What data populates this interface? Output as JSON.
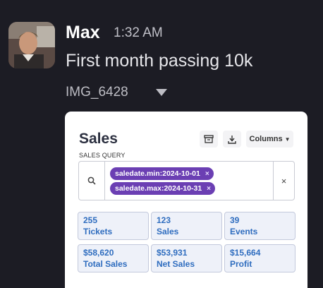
{
  "message": {
    "sender": "Max",
    "time": "1:32 AM",
    "text": "First month passing 10k",
    "attachment": {
      "name": "IMG_6428",
      "icon": "chevron-down-icon"
    }
  },
  "screenshot": {
    "title": "Sales",
    "toolbar": {
      "archive_icon": "archive-icon",
      "download_icon": "download-icon",
      "columns_label": "Columns"
    },
    "query": {
      "label": "SALES QUERY",
      "filters": [
        {
          "text": "saledate.min:2024-10-01"
        },
        {
          "text": "saledate.max:2024-10-31"
        }
      ],
      "remove_glyph": "×",
      "clear_glyph": "×"
    },
    "stats": [
      {
        "value": "255",
        "label": "Tickets"
      },
      {
        "value": "123",
        "label": "Sales"
      },
      {
        "value": "39",
        "label": "Events"
      },
      {
        "value": "$58,620",
        "label": "Total Sales"
      },
      {
        "value": "$53,931",
        "label": "Net Sales"
      },
      {
        "value": "$15,664",
        "label": "Profit"
      }
    ]
  },
  "colors": {
    "background": "#1c1c24",
    "chip": "#6b3fb3",
    "stat_text": "#2f6dbf"
  }
}
